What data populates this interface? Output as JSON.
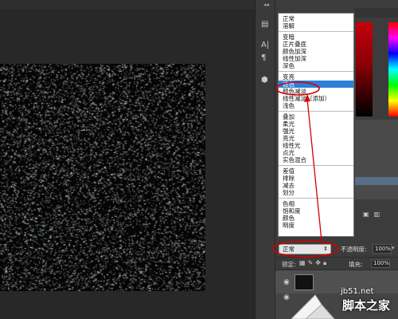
{
  "blend_menu": {
    "groups": [
      [
        "正常",
        "溶解"
      ],
      [
        "变暗",
        "正片叠底",
        "颜色加深",
        "线性加深",
        "深色"
      ],
      [
        "变亮",
        "滤色",
        "颜色减淡",
        "线性减淡（添加）",
        "浅色"
      ],
      [
        "叠加",
        "柔光",
        "强光",
        "亮光",
        "线性光",
        "点光",
        "实色混合"
      ],
      [
        "差值",
        "排除",
        "减去",
        "划分"
      ],
      [
        "色相",
        "饱和度",
        "颜色",
        "明度"
      ]
    ],
    "selected": "滤色"
  },
  "layers_panel": {
    "blend_mode_value": "正常",
    "opacity_label": "不透明度:",
    "opacity_value": "100%",
    "lock_label": "锁定:",
    "fill_label": "填充:",
    "fill_value": "100%"
  },
  "watermark": {
    "site": "jb51.net",
    "name": "脚本之家"
  },
  "colors": {
    "menu_highlight": "#2d7fd8",
    "annotation_red": "#d40000",
    "panel_bg": "#3c3c3c",
    "canvas_bg": "#282828"
  },
  "icons": [
    "text-A-icon",
    "paragraph-icon",
    "3d-cube-icon",
    "eye-icon",
    "lock-icon",
    "brush-icon",
    "move-icon"
  ]
}
